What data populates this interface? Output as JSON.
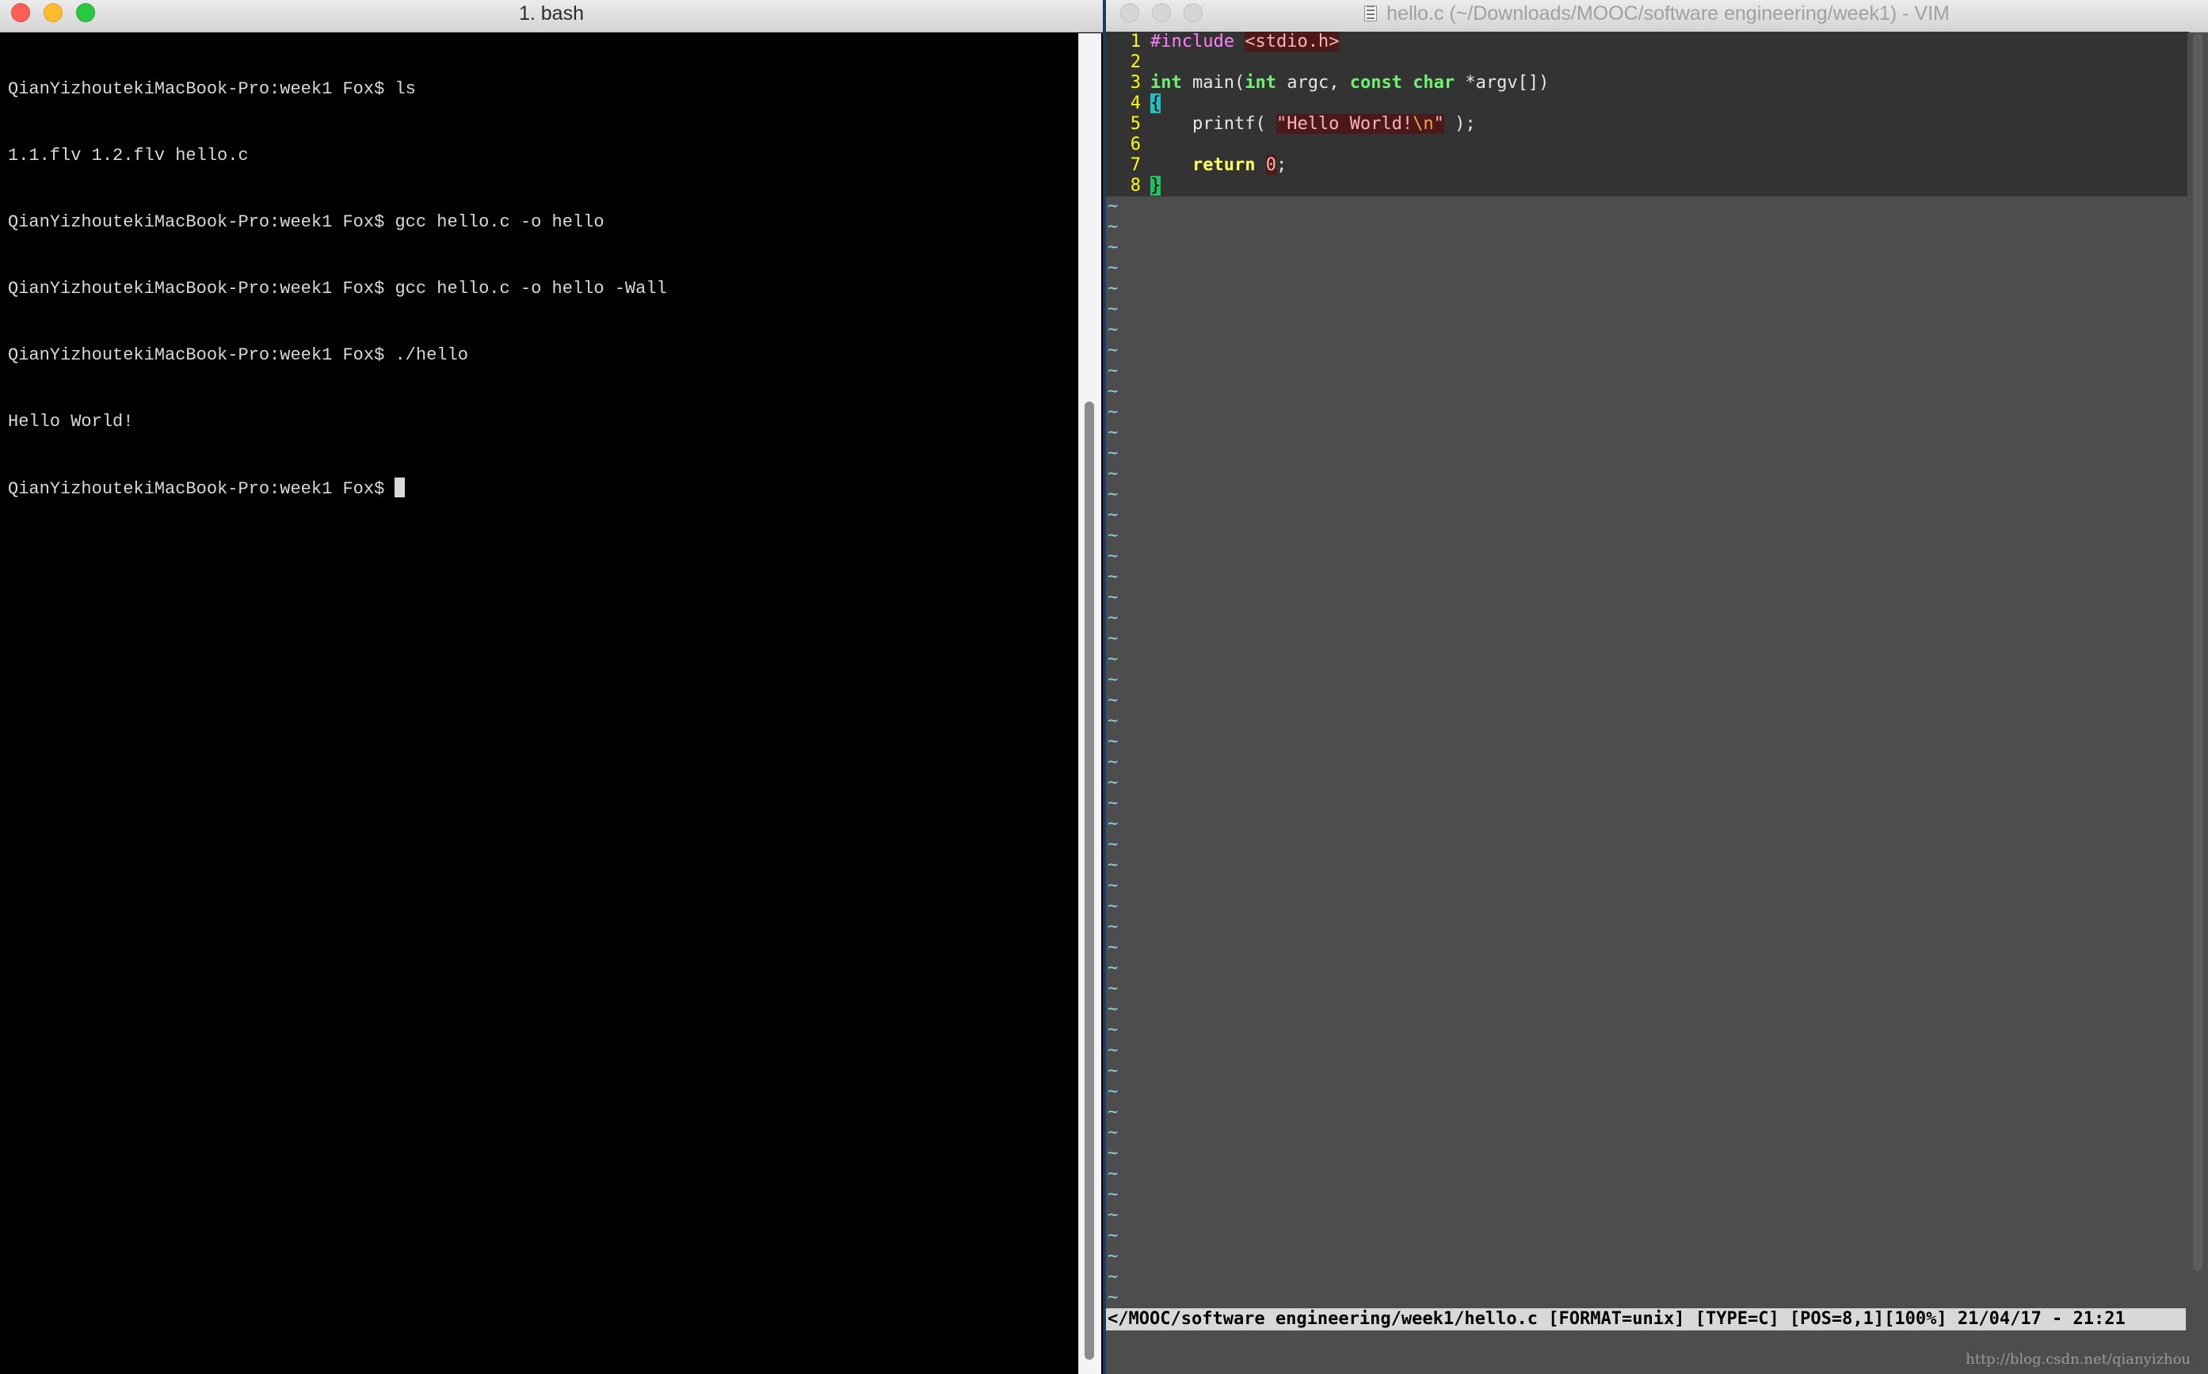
{
  "terminal": {
    "title": "1. bash",
    "lines": [
      "QianYizhoutekiMacBook-Pro:week1 Fox$ ls",
      "1.1.flv 1.2.flv hello.c",
      "QianYizhoutekiMacBook-Pro:week1 Fox$ gcc hello.c -o hello",
      "QianYizhoutekiMacBook-Pro:week1 Fox$ gcc hello.c -o hello -Wall",
      "QianYizhoutekiMacBook-Pro:week1 Fox$ ./hello",
      "Hello World!"
    ],
    "prompt": "QianYizhoutekiMacBook-Pro:week1 Fox$ "
  },
  "vim": {
    "title": "hello.c (~/Downloads/MOOC/software engineering/week1) - VIM",
    "line_numbers": [
      "1",
      "2",
      "3",
      "4",
      "5",
      "6",
      "7",
      "8"
    ],
    "code": {
      "include_kw": "#include",
      "include_hdr": "<stdio.h>",
      "int1": "int",
      "main_open": " main(",
      "int2": "int",
      "argc": " argc, ",
      "const": "const",
      "char": "char",
      "argv": " *argv[])",
      "open_brace": "{",
      "printf_open": "    printf( ",
      "str_a": "\"Hello World!",
      "str_esc": "\\n",
      "str_b": "\"",
      "printf_close": " );",
      "return_kw": "return",
      "zero": "0",
      "semicolon": ";",
      "close_brace": "}"
    },
    "tilde": "~",
    "status_line": "</MOOC/software engineering/week1/hello.c [FORMAT=unix] [TYPE=C] [POS=8,1][100%] 21/04/17 - 21:21"
  },
  "watermark": "http://blog.csdn.net/qianyizhou",
  "colors": {
    "terminal_bg": "#000000",
    "vim_bg": "#4d4d4d",
    "vim_code_bg": "#333333",
    "line_number": "#ffff00",
    "tilde": "#8ad6e6"
  }
}
